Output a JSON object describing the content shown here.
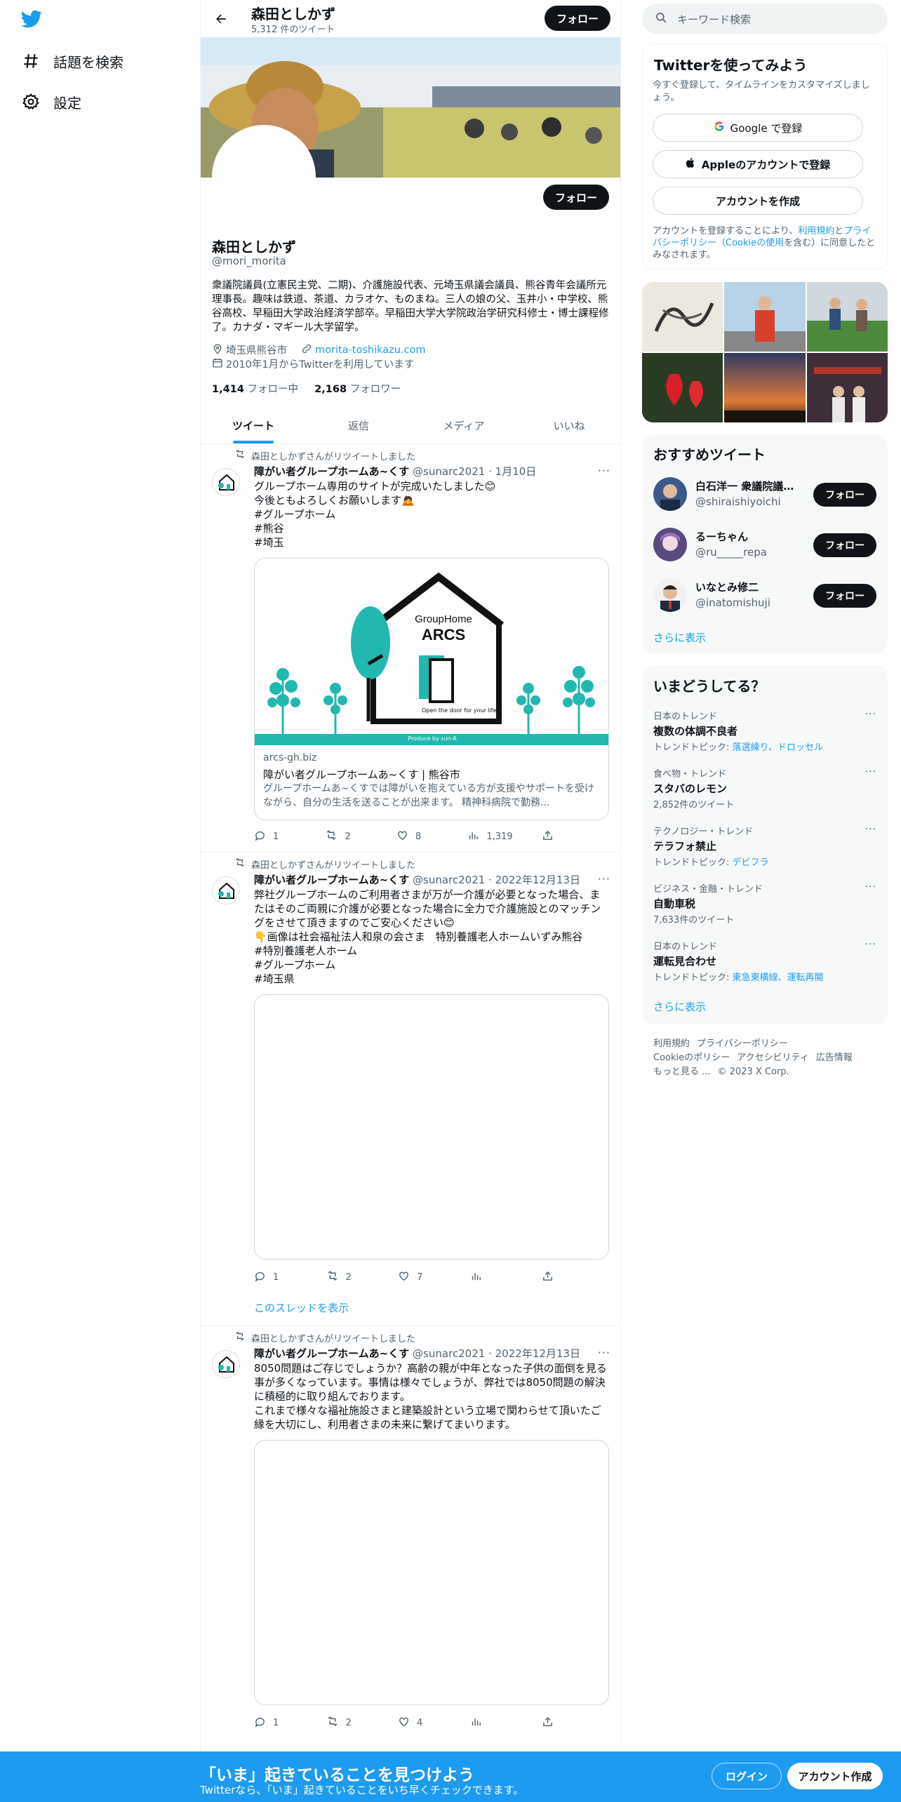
{
  "nav": {
    "explore_label": "話題を検索",
    "settings_label": "設定"
  },
  "header": {
    "name": "森田としかず",
    "tweet_count": "5,312 件のツイート",
    "follow_label": "フォロー"
  },
  "profile": {
    "name": "森田としかず",
    "handle": "@mori_morita",
    "follow_label": "フォロー",
    "bio": "衆議院議員(立憲民主党、二期)、介護施設代表、元埼玉県議会議員、熊谷青年会議所元理事長。趣味は鉄道、茶道、カラオケ、ものまね。三人の娘の父、玉井小・中学校、熊谷高校、早稲田大学政治経済学部卒。早稲田大学大学院政治学研究科修士・博士課程修了。カナダ・マギール大学留学。",
    "location": "埼玉県熊谷市",
    "website": "morita-toshikazu.com",
    "joined": "2010年1月からTwitterを利用しています",
    "following_count": "1,414",
    "following_label": "フォロー中",
    "followers_count": "2,168",
    "followers_label": "フォロワー"
  },
  "tabs": [
    {
      "label": "ツイート",
      "active": true
    },
    {
      "label": "返信",
      "active": false
    },
    {
      "label": "メディア",
      "active": false
    },
    {
      "label": "いいね",
      "active": false
    }
  ],
  "tweets": [
    {
      "retweet_label": "森田としかずさんがリツイートしました",
      "author": "障がい者グループホームあ~くす",
      "handle": "@sunarc2021",
      "date": "1月10日",
      "text": "グループホーム専用のサイトが完成いたしました😊\n今後ともよろしくお願いします🙇\n#グループホーム\n#熊谷\n#埼玉",
      "card": {
        "logo_line1": "GroupHome",
        "logo_line2": "ARCS",
        "tagline": "Open the door for your life",
        "banner_text": "Produce by sun-A",
        "domain": "arcs-gh.biz",
        "title": "障がい者グループホームあ~くす | 熊谷市",
        "desc": "グループホームあ~くすでは障がいを抱えている方が支援やサポートを受けながら、自分の生活を送ることが出来ます。 精神科病院で勤務..."
      },
      "stats": {
        "replies": "1",
        "retweets": "2",
        "likes": "8",
        "views": "1,319"
      }
    },
    {
      "retweet_label": "森田としかずさんがリツイートしました",
      "author": "障がい者グループホームあ~くす",
      "handle": "@sunarc2021",
      "date": "2022年12月13日",
      "text": "弊社グループホームのご利用者さまが万が一介護が必要となった場合、またはそのご両親に介護が必要となった場合に全力で介護施設とのマッチングをさせて頂きますのでご安心ください😊\n👇画像は社会福祉法人和泉の会さま　特別養護老人ホームいずみ熊谷\n#特別養護老人ホーム\n#グループホーム\n#埼玉県",
      "stats": {
        "replies": "1",
        "retweets": "2",
        "likes": "7",
        "views": ""
      },
      "thread_label": "このスレッドを表示"
    },
    {
      "retweet_label": "森田としかずさんがリツイートしました",
      "author": "障がい者グループホームあ~くす",
      "handle": "@sunarc2021",
      "date": "2022年12月13日",
      "text": "8050問題はご存じでしょうか？高齢の親が中年となった子供の面倒を見る事が多くなっています。事情は様々でしょうが、弊社では8050問題の解決に積極的に取り組んでおります。\nこれまで様々な福祉施設さまと建築設計という立場で関わらせて頂いたご縁を大切にし、利用者さまの未来に繋げてまいります。",
      "stats": {
        "replies": "1",
        "retweets": "2",
        "likes": "4",
        "views": ""
      }
    }
  ],
  "right": {
    "search_placeholder": "キーワード検索",
    "signup": {
      "title": "Twitterを使ってみよう",
      "subtitle": "今すぐ登録して、タイムラインをカスタマイズしましょう。",
      "google": "Google で登録",
      "apple": "Appleのアカウントで登録",
      "create": "アカウントを作成",
      "terms_pre": "アカウントを登録することにより、",
      "terms_link1": "利用規約",
      "terms_mid": "と",
      "terms_link2": "プライバシーポリシー（Cookieの使用",
      "terms_post": "を含む）に同意したとみなされます。"
    },
    "recommended": {
      "title": "おすすめツイート",
      "users": [
        {
          "name": "白石洋一 衆議院議員...",
          "handle": "@shiraishiyoichi",
          "follow": "フォロー"
        },
        {
          "name": "るーちゃん",
          "handle": "@ru_____repa",
          "follow": "フォロー"
        },
        {
          "name": "いなとみ修二",
          "handle": "@inatomishuji",
          "follow": "フォロー"
        }
      ],
      "show_more": "さらに表示"
    },
    "trends": {
      "title": "いまどうしてる？",
      "items": [
        {
          "category": "日本のトレンド",
          "title": "複数の体調不良者",
          "sub_pre": "トレンドトピック: ",
          "sub_link": "落選繰り、ドロッセル"
        },
        {
          "category": "食べ物・トレンド",
          "title": "スタバのレモン",
          "sub_pre": "2,852件のツイート",
          "sub_link": ""
        },
        {
          "category": "テクノロジー・トレンド",
          "title": "テラフォ禁止",
          "sub_pre": "トレンドトピック: ",
          "sub_link": "デビフラ"
        },
        {
          "category": "ビジネス・金融・トレンド",
          "title": "自動車税",
          "sub_pre": "7,633件のツイート",
          "sub_link": ""
        },
        {
          "category": "日本のトレンド",
          "title": "運転見合わせ",
          "sub_pre": "トレンドトピック: ",
          "sub_link": "東急東横線、運転再開"
        }
      ],
      "show_more": "さらに表示"
    },
    "footer": {
      "terms": "利用規約",
      "privacy": "プライバシーポリシー",
      "cookie": "Cookieのポリシー",
      "accessibility": "アクセシビリティ",
      "ads": "広告情報",
      "more": "もっと見る ...",
      "copyright": "© 2023 X Corp."
    }
  },
  "bottombar": {
    "heading": "「いま」起きていることを見つけよう",
    "sub": "Twitterなら、「いま」起きていることをいち早くチェックできます。",
    "login": "ログイン",
    "signup": "アカウント作成"
  },
  "colors": {
    "accent": "#1d9bf0",
    "dark": "#0f1419",
    "muted": "#536471"
  }
}
